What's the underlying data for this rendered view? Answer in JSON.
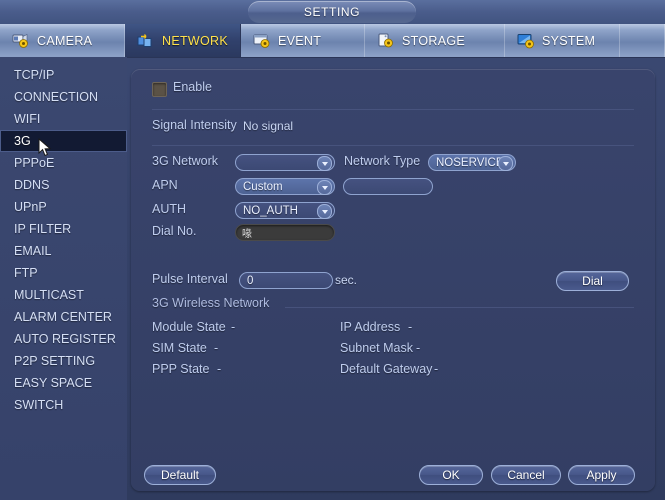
{
  "window": {
    "title": "SETTING"
  },
  "tabs": [
    {
      "label": "CAMERA",
      "icon": "camera-gear-icon",
      "active": false
    },
    {
      "label": "NETWORK",
      "icon": "network-gear-icon",
      "active": true
    },
    {
      "label": "EVENT",
      "icon": "event-gear-icon",
      "active": false
    },
    {
      "label": "STORAGE",
      "icon": "storage-gear-icon",
      "active": false
    },
    {
      "label": "SYSTEM",
      "icon": "system-gear-icon",
      "active": false
    }
  ],
  "sidebar": {
    "selected": "3G",
    "items": [
      {
        "label": "TCP/IP"
      },
      {
        "label": "CONNECTION"
      },
      {
        "label": "WIFI"
      },
      {
        "label": "3G"
      },
      {
        "label": "PPPoE"
      },
      {
        "label": "DDNS"
      },
      {
        "label": "UPnP"
      },
      {
        "label": "IP FILTER"
      },
      {
        "label": "EMAIL"
      },
      {
        "label": "FTP"
      },
      {
        "label": "MULTICAST"
      },
      {
        "label": "ALARM CENTER"
      },
      {
        "label": "AUTO REGISTER"
      },
      {
        "label": "P2P SETTING"
      },
      {
        "label": "EASY SPACE"
      },
      {
        "label": "SWITCH"
      }
    ]
  },
  "form": {
    "enable": {
      "label": "Enable",
      "checked": false
    },
    "signal_intensity": {
      "label": "Signal Intensity",
      "value": "No signal"
    },
    "network_3g": {
      "label": "3G Network",
      "value": ""
    },
    "network_type": {
      "label": "Network Type",
      "value": "NOSERVICE"
    },
    "apn": {
      "label": "APN",
      "value": "Custom",
      "extra_value": ""
    },
    "auth": {
      "label": "AUTH",
      "value": "NO_AUTH"
    },
    "dial_no": {
      "label": "Dial No.",
      "value": "喙"
    },
    "pulse_interval": {
      "label": "Pulse Interval",
      "value": "0",
      "unit": "sec."
    },
    "dial_button": "Dial"
  },
  "status": {
    "section_title": "3G Wireless Network",
    "left": [
      {
        "label": "Module State",
        "value": "-"
      },
      {
        "label": "SIM State",
        "value": "-"
      },
      {
        "label": "PPP State",
        "value": "-"
      }
    ],
    "right": [
      {
        "label": "IP Address",
        "value": "-"
      },
      {
        "label": "Subnet Mask",
        "value": "-"
      },
      {
        "label": "Default Gateway",
        "value": "-"
      }
    ]
  },
  "footer": {
    "default": "Default",
    "ok": "OK",
    "cancel": "Cancel",
    "apply": "Apply"
  },
  "colors": {
    "accent_active_tab_text": "#ffe24d",
    "panel_bg": "#39446c",
    "selection_bg": "#121a33"
  }
}
